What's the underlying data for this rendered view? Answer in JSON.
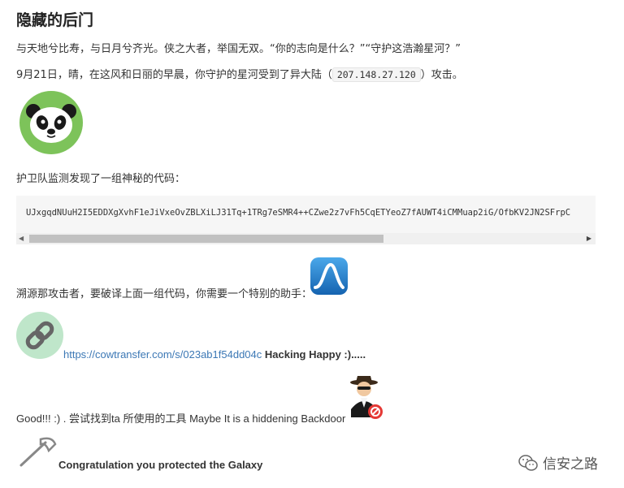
{
  "page": {
    "title": "隐藏的后门",
    "intro": "与天地兮比寿，与日月兮齐光。侠之大者，举国无双。“你的志向是什么？”“守护这浩瀚星河？”",
    "attack_prefix": "9月21日，晴，在这风和日丽的早晨，你守护的星河受到了异大陆（",
    "attack_ip": "207.148.27.120",
    "attack_suffix": "）攻击。",
    "found_code": "护卫队监测发现了一组神秘的代码：",
    "code": "UJxgqdNUuH2I5EDDXgXvhF1eJiVxeOvZBLXiLJ31Tq+1TRg7eSMR4++CZwe2z7vFh5CqETYeoZ7fAUWT4iCMMuap2iG/OfbKV2JN2SFrpC",
    "trace": "溯源那攻击者，要破译上面一组代码，你需要一个特别的助手：",
    "link_url": "https://cowtransfer.com/s/023ab1f54dd04c",
    "link_after": "Hacking Happy :).....",
    "good": "Good!!! :) . 尝试找到ta 所使用的工具 Maybe It is a hiddening Backdoor",
    "congrats": "Congratulation you protected the Galaxy"
  },
  "watermark": {
    "text": "信安之路",
    "icon": "wechat-icon"
  },
  "icons": {
    "panda": "panda-icon",
    "wireshark": "wireshark-icon",
    "link": "link-icon",
    "hacker": "hacker-icon",
    "axe": "axe-icon"
  },
  "colors": {
    "link": "#3c78b5",
    "panda_bg": "#7dc35a",
    "wireshark": "#1c7ec8",
    "link_bg": "#bfe6ca",
    "code_bg": "#f6f6f6"
  }
}
